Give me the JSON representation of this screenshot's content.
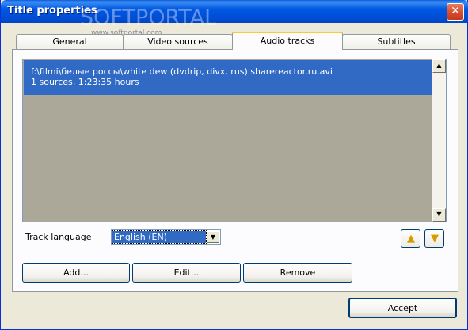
{
  "window": {
    "title": "Title properties",
    "watermark": "SOFTPORTAL",
    "watermark_sub": "www.softportal.com",
    "close_glyph": "✕"
  },
  "tabs": [
    {
      "label": "General",
      "active": false
    },
    {
      "label": "Video sources",
      "active": false
    },
    {
      "label": "Audio tracks",
      "active": true
    },
    {
      "label": "Subtitles",
      "active": false
    }
  ],
  "tracks": {
    "items": [
      {
        "line1": "f:\\filmi\\белые россы\\white dew (dvdrip, divx, rus) sharereactor.ru.avi",
        "line2": "1 sources, 1:23:35 hours",
        "selected": true
      }
    ]
  },
  "language": {
    "label": "Track language",
    "value": "English (EN)"
  },
  "icons": {
    "move_up": "arrow-up-icon",
    "move_down": "arrow-down-icon",
    "scroll_up": "scroll-up-arrow-icon",
    "scroll_down": "scroll-down-arrow-icon",
    "dropdown": "chevron-down-icon"
  },
  "buttons": {
    "add": "Add...",
    "edit": "Edit...",
    "remove": "Remove",
    "accept": "Accept"
  },
  "colors": {
    "selection": "#316ac5",
    "list_background": "#aca899",
    "titlebar": "#0058e3",
    "active_tab_accent": "#ffc83c"
  }
}
